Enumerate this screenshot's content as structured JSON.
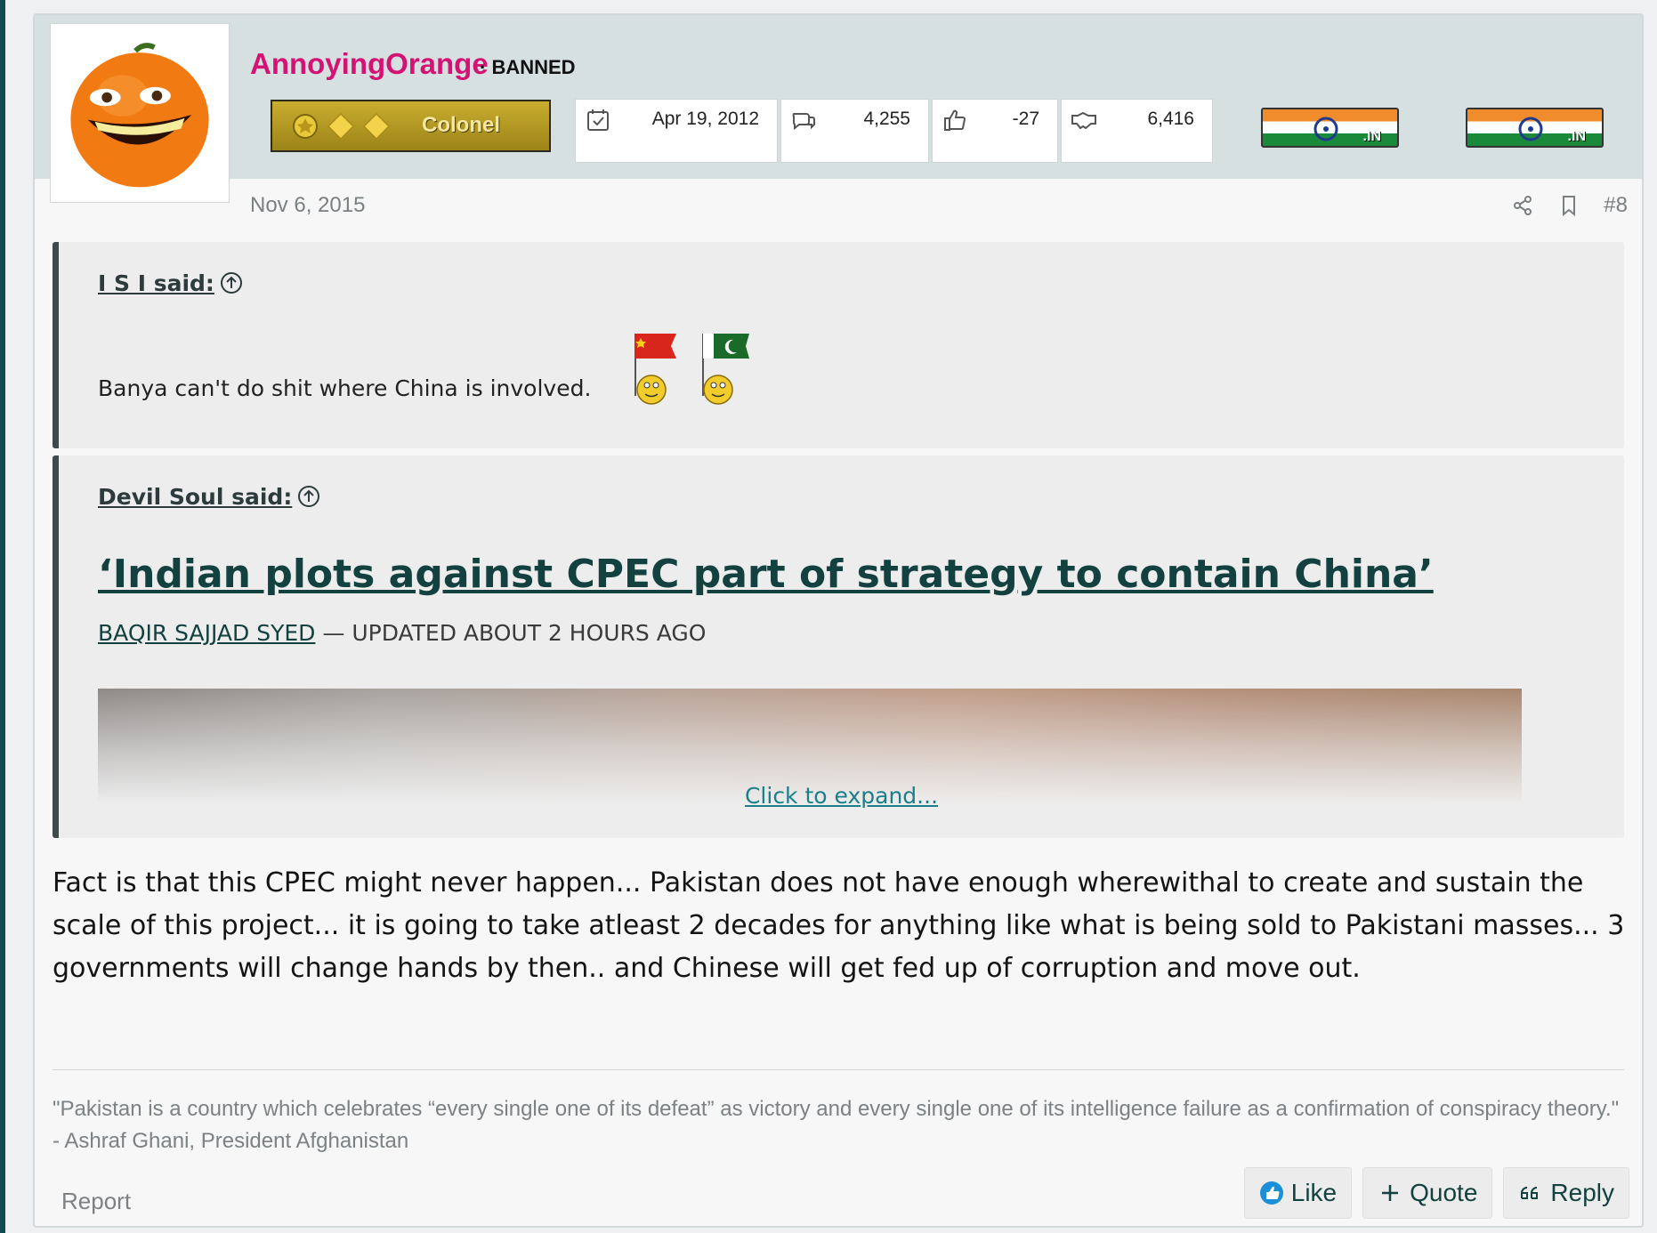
{
  "user": {
    "name": "AnnoyingOrange",
    "status": "· BANNED",
    "rank": "Colonel",
    "name_color": "#d31273"
  },
  "stats": [
    {
      "icon": "calendar-check-icon",
      "value": "Apr 19, 2012"
    },
    {
      "icon": "comments-icon",
      "value": "4,255"
    },
    {
      "icon": "thumbs-up-icon",
      "value": "-27"
    },
    {
      "icon": "handshake-icon",
      "value": "6,416"
    }
  ],
  "flags": [
    ".IN",
    ".IN"
  ],
  "post": {
    "date": "Nov 6, 2015",
    "number": "#8",
    "body": "Fact is that this CPEC might never happen... Pakistan does not have enough wherewithal to create and sustain the scale of this project... it is going to take atleast 2 decades for anything like what is being sold to Pakistani masses... 3 governments will change hands by then.. and Chinese will get fed up of corruption and move out."
  },
  "quote1": {
    "author": "I S I said:",
    "text": "Banya can't do shit where China is involved."
  },
  "quote2": {
    "author": "Devil Soul said:",
    "article_title": "‘Indian plots against CPEC part of strategy to contain China’",
    "byline_author": "BAQIR SAJJAD SYED",
    "byline_rest": " — UPDATED ABOUT 2 HOURS AGO",
    "expand": "Click to expand..."
  },
  "signature": "\"Pakistan is a country which celebrates “every single one of its defeat” as victory and every single one of its intelligence failure as a confirmation of conspiracy theory.\" - Ashraf Ghani, President Afghanistan",
  "footer": {
    "report": "Report",
    "like": "Like",
    "quote": "Quote",
    "reply": "Reply"
  },
  "colors": {
    "accent": "#13413f",
    "link": "#1b7f8a",
    "header_bg": "#d7e0e1"
  }
}
